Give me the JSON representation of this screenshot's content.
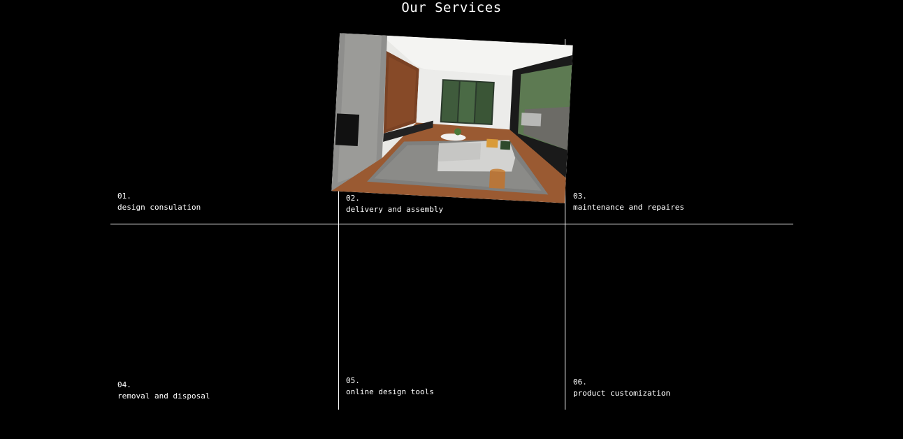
{
  "section": {
    "title": "Our Services"
  },
  "services": [
    {
      "num": "01.",
      "label": "design consulation"
    },
    {
      "num": "02.",
      "label": "delivery and assembly"
    },
    {
      "num": "03.",
      "label": "maintenance and repaires"
    },
    {
      "num": "04.",
      "label": "removal and disposal"
    },
    {
      "num": "05.",
      "label": "online design tools"
    },
    {
      "num": "06.",
      "label": "product customization"
    }
  ],
  "colors": {
    "background": "#000000",
    "text": "#ffffff",
    "divider": "#ffffff"
  }
}
